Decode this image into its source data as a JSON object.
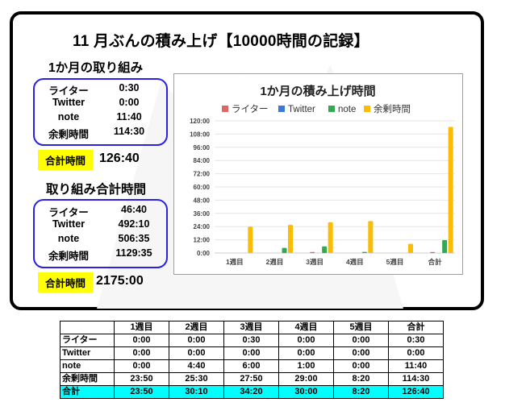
{
  "page": {
    "title": "11 月ぶんの積み上げ【10000時間の記録】"
  },
  "monthly": {
    "heading": "1か月の取り組み",
    "rows": [
      {
        "label": "ライター",
        "value": "0:30"
      },
      {
        "label": "Twitter",
        "value": "0:00"
      },
      {
        "label": "note",
        "value": "11:40"
      },
      {
        "label": "余剰時間",
        "value": "114:30"
      }
    ],
    "total_label": "合計時間",
    "total_value": "126:40"
  },
  "cumulative": {
    "heading": "取り組み合計時間",
    "rows": [
      {
        "label": "ライター",
        "value": "46:40"
      },
      {
        "label": "Twitter",
        "value": "492:10"
      },
      {
        "label": "note",
        "value": "506:35"
      },
      {
        "label": "余剰時間",
        "value": "1129:35"
      }
    ],
    "total_label": "合計時間",
    "total_value": "2175:00"
  },
  "colors": {
    "frame": "#000000",
    "summary_border": "#2a22e0",
    "total_badge": "#ffff00",
    "table_total_row": "#00ffff",
    "grid": "#e6e6e6",
    "chart_border": "#9e9e9e"
  },
  "chart_data": {
    "type": "bar",
    "title": "1か月の積み上げ時間",
    "categories": [
      "1週目",
      "2週目",
      "3週目",
      "4週目",
      "5週目",
      "合計"
    ],
    "series": [
      {
        "name": "ライター",
        "color": "#e06666",
        "values": [
          0,
          0,
          0.5,
          0,
          0,
          0.5
        ]
      },
      {
        "name": "Twitter",
        "color": "#3c78d8",
        "values": [
          0,
          0,
          0,
          0,
          0,
          0
        ]
      },
      {
        "name": "note",
        "color": "#34a853",
        "values": [
          0,
          4.667,
          6,
          1,
          0,
          11.667
        ]
      },
      {
        "name": "余剰時間",
        "color": "#fbbc04",
        "values": [
          23.833,
          25.5,
          27.833,
          29,
          8.333,
          114.5
        ]
      }
    ],
    "xlabel": "",
    "ylabel": "",
    "ylim": [
      0,
      120
    ],
    "yticks": [
      "0:00",
      "12:00",
      "24:00",
      "36:00",
      "48:00",
      "60:00",
      "72:00",
      "84:00",
      "96:00",
      "108:00",
      "120:00"
    ],
    "ytick_values": [
      0,
      12,
      24,
      36,
      48,
      60,
      72,
      84,
      96,
      108,
      120
    ],
    "grid": true,
    "legend_position": "top"
  },
  "table": {
    "headers": [
      "",
      "1週目",
      "2週目",
      "3週目",
      "4週目",
      "5週目",
      "合計"
    ],
    "rows": [
      {
        "label": "ライター",
        "cells": [
          "0:00",
          "0:00",
          "0:30",
          "0:00",
          "0:00",
          "0:30"
        ]
      },
      {
        "label": "Twitter",
        "cells": [
          "0:00",
          "0:00",
          "0:00",
          "0:00",
          "0:00",
          "0:00"
        ]
      },
      {
        "label": "note",
        "cells": [
          "0:00",
          "4:40",
          "6:00",
          "1:00",
          "0:00",
          "11:40"
        ]
      },
      {
        "label": "余剰時間",
        "cells": [
          "23:50",
          "25:30",
          "27:50",
          "29:00",
          "8:20",
          "114:30"
        ]
      }
    ],
    "total_row": {
      "label": "合計",
      "cells": [
        "23:50",
        "30:10",
        "34:20",
        "30:00",
        "8:20",
        "126:40"
      ]
    }
  }
}
